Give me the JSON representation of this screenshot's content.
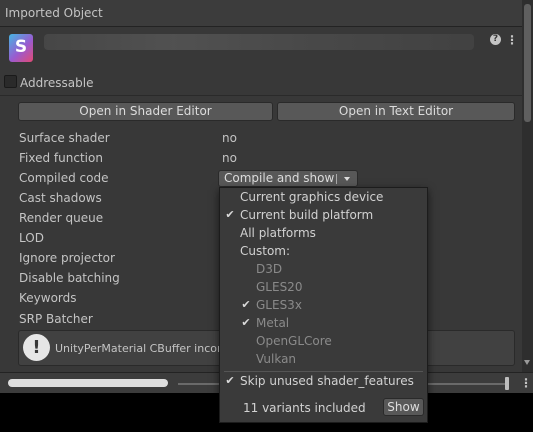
{
  "header": {
    "title": "Imported Object"
  },
  "asset": {
    "icon_letter": "S"
  },
  "addressable": {
    "label": "Addressable",
    "checked": false
  },
  "buttons": {
    "open_shader_editor": "Open in Shader Editor",
    "open_text_editor": "Open in Text Editor"
  },
  "properties": [
    {
      "label": "Surface shader",
      "value": "no"
    },
    {
      "label": "Fixed function",
      "value": "no"
    },
    {
      "label": "Compiled code",
      "value": ""
    },
    {
      "label": "Cast shadows",
      "value": ""
    },
    {
      "label": "Render queue",
      "value": ""
    },
    {
      "label": "LOD",
      "value": ""
    },
    {
      "label": "Ignore projector",
      "value": ""
    },
    {
      "label": "Disable batching",
      "value": ""
    },
    {
      "label": "Keywords",
      "value": ""
    },
    {
      "label": "SRP Batcher",
      "value": ""
    }
  ],
  "compile_dropdown": {
    "label": "Compile and show code"
  },
  "warning": {
    "text": "UnityPerMaterial CBuffer inconsistent size inside a SubShader"
  },
  "popup_menu": {
    "items": [
      {
        "label": "Current graphics device",
        "checked": false,
        "indent": false,
        "disabled": false
      },
      {
        "label": "Current build platform",
        "checked": true,
        "indent": false,
        "disabled": false
      },
      {
        "label": "All platforms",
        "checked": false,
        "indent": false,
        "disabled": false
      },
      {
        "label": "Custom:",
        "checked": false,
        "indent": false,
        "disabled": false
      },
      {
        "label": "D3D",
        "checked": false,
        "indent": true,
        "disabled": true
      },
      {
        "label": "GLES20",
        "checked": false,
        "indent": true,
        "disabled": true
      },
      {
        "label": "GLES3x",
        "checked": true,
        "indent": true,
        "disabled": true
      },
      {
        "label": "Metal",
        "checked": true,
        "indent": true,
        "disabled": true
      },
      {
        "label": "OpenGLCore",
        "checked": false,
        "indent": true,
        "disabled": true
      },
      {
        "label": "Vulkan",
        "checked": false,
        "indent": true,
        "disabled": true
      }
    ],
    "skip_unused": {
      "label": "Skip unused shader_features",
      "checked": true
    },
    "variants_label": "11 variants included",
    "show_button": "Show"
  },
  "icons": {
    "help": "help-icon",
    "menu": "kebab-menu-icon",
    "warning": "warning-icon",
    "checkmark": "checkmark-icon"
  },
  "colors": {
    "panel_bg": "#383838",
    "button_bg": "#585858",
    "popup_bg": "#3a3a3a",
    "text": "#c4c4c4",
    "disabled_text": "#8a8a8a"
  }
}
